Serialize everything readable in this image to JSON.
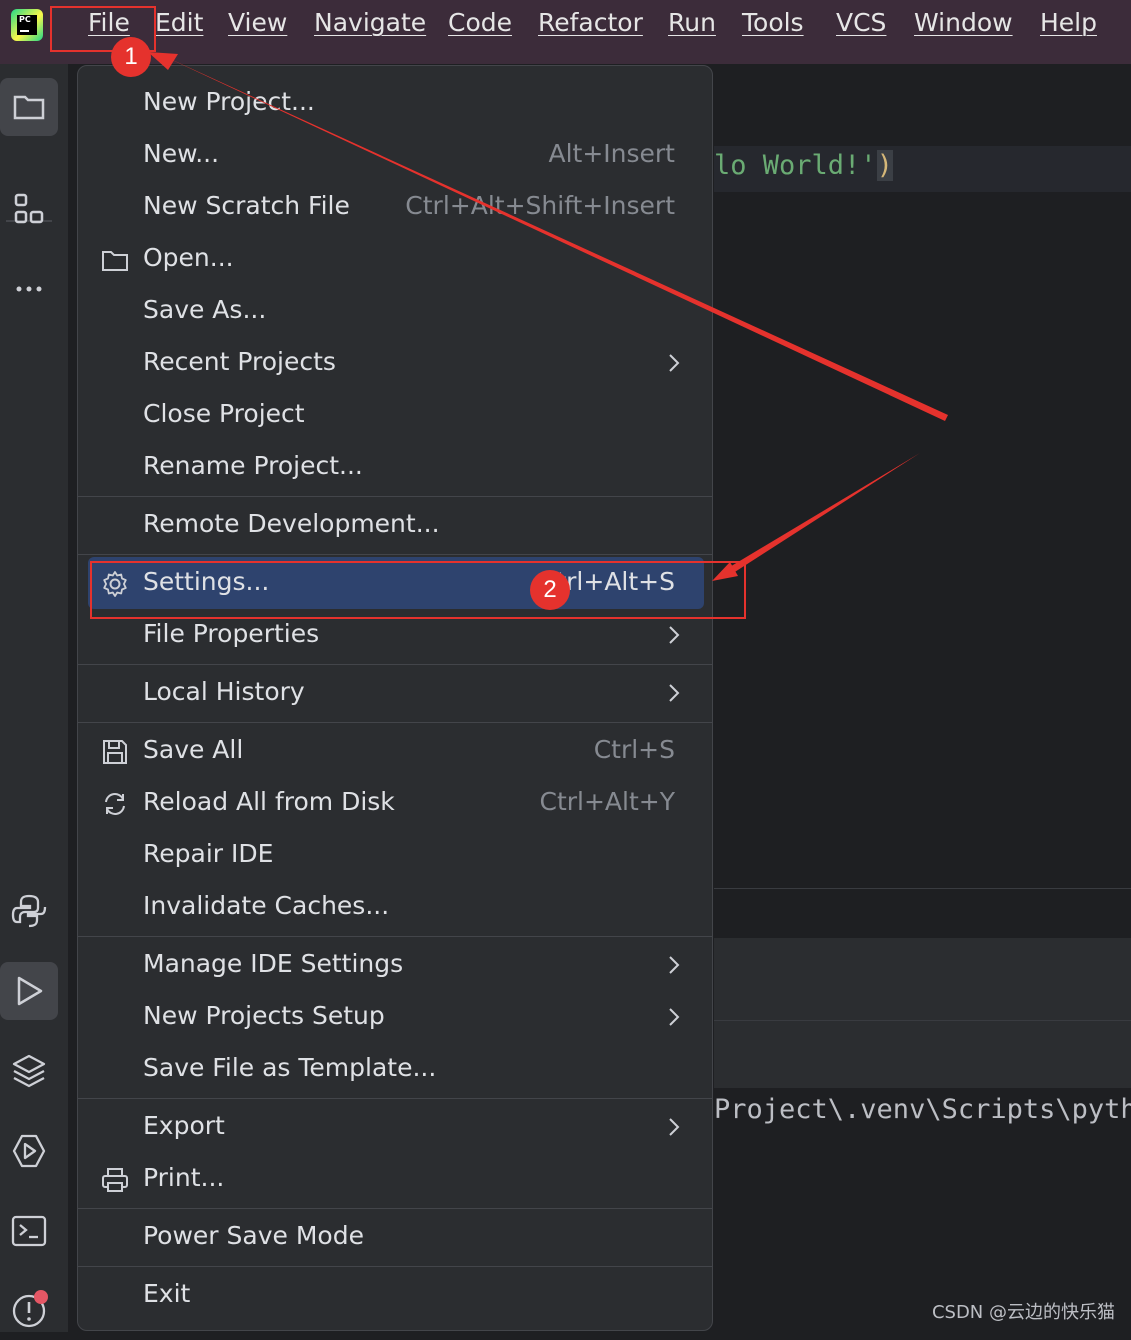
{
  "menubar": {
    "items": [
      "File",
      "Edit",
      "View",
      "Navigate",
      "Code",
      "Refactor",
      "Run",
      "Tools",
      "VCS",
      "Window",
      "Help"
    ]
  },
  "app": {
    "logo_text": "PC",
    "icon": "pycharm-logo"
  },
  "editor": {
    "code_snippet": "lo World!'",
    "code_paren": ")",
    "console_snippet": "Project\\.venv\\Scripts\\pyth"
  },
  "file_menu": {
    "items": [
      {
        "label": "New Project...",
        "shortcut": ""
      },
      {
        "label": "New...",
        "shortcut": "Alt+Insert"
      },
      {
        "label": "New Scratch File",
        "shortcut": "Ctrl+Alt+Shift+Insert"
      },
      {
        "label": "Open...",
        "shortcut": "",
        "icon": "folder-icon"
      },
      {
        "label": "Save As...",
        "shortcut": ""
      },
      {
        "label": "Recent Projects",
        "shortcut": "",
        "submenu": true
      },
      {
        "label": "Close Project",
        "shortcut": ""
      },
      {
        "label": "Rename Project...",
        "shortcut": ""
      },
      {
        "label": "Remote Development...",
        "shortcut": ""
      },
      {
        "label": "Settings...",
        "shortcut": "Ctrl+Alt+S",
        "icon": "gear-icon",
        "selected": true
      },
      {
        "label": "File Properties",
        "shortcut": "",
        "submenu": true
      },
      {
        "label": "Local History",
        "shortcut": "",
        "submenu": true
      },
      {
        "label": "Save All",
        "shortcut": "Ctrl+S",
        "icon": "save-icon"
      },
      {
        "label": "Reload All from Disk",
        "shortcut": "Ctrl+Alt+Y",
        "icon": "reload-icon"
      },
      {
        "label": "Repair IDE",
        "shortcut": ""
      },
      {
        "label": "Invalidate Caches...",
        "shortcut": ""
      },
      {
        "label": "Manage IDE Settings",
        "shortcut": "",
        "submenu": true
      },
      {
        "label": "New Projects Setup",
        "shortcut": "",
        "submenu": true
      },
      {
        "label": "Save File as Template...",
        "shortcut": ""
      },
      {
        "label": "Export",
        "shortcut": "",
        "submenu": true
      },
      {
        "label": "Print...",
        "shortcut": "",
        "icon": "print-icon"
      },
      {
        "label": "Power Save Mode",
        "shortcut": ""
      },
      {
        "label": "Exit",
        "shortcut": ""
      }
    ]
  },
  "annotations": {
    "step1": "1",
    "step2": "2"
  },
  "watermark": "CSDN @云边的快乐猫",
  "colors": {
    "selection": "#2e436e",
    "annotation": "#e5322d",
    "menubar": "#3c2c3a"
  }
}
